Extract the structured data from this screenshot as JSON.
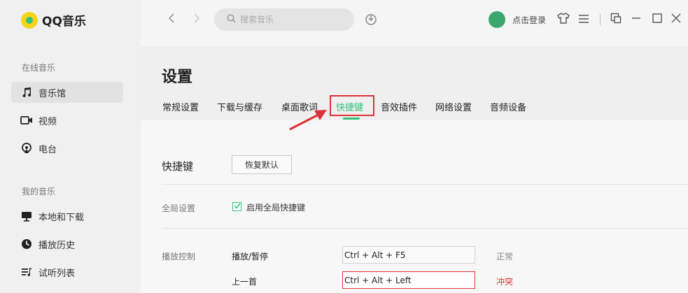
{
  "app": {
    "name": "QQ音乐"
  },
  "sidebar": {
    "online_title": "在线音乐",
    "online_items": [
      {
        "label": "音乐馆",
        "icon": "music-note-icon",
        "active": true
      },
      {
        "label": "视频",
        "icon": "video-icon",
        "active": false
      },
      {
        "label": "电台",
        "icon": "radio-icon",
        "active": false
      }
    ],
    "my_title": "我的音乐",
    "my_items": [
      {
        "label": "本地和下载",
        "icon": "monitor-icon"
      },
      {
        "label": "播放历史",
        "icon": "history-icon"
      },
      {
        "label": "试听列表",
        "icon": "playlist-icon"
      }
    ]
  },
  "topbar": {
    "search_placeholder": "搜索音乐",
    "login_label": "点击登录"
  },
  "settings": {
    "title": "设置",
    "tabs": [
      {
        "label": "常规设置",
        "active": false
      },
      {
        "label": "下载与缓存",
        "active": false
      },
      {
        "label": "桌面歌词",
        "active": false
      },
      {
        "label": "快捷键",
        "active": true
      },
      {
        "label": "音效插件",
        "active": false
      },
      {
        "label": "网络设置",
        "active": false
      },
      {
        "label": "音频设备",
        "active": false
      }
    ],
    "section_title": "快捷键",
    "restore_default_label": "恢复默认",
    "global_label": "全局设置",
    "enable_global_label": "启用全局快捷键",
    "enable_global_checked": true,
    "playback_label": "播放控制",
    "hotkeys": [
      {
        "action": "播放/暂停",
        "value": "Ctrl + Alt + F5",
        "status": "正常",
        "conflict": false
      },
      {
        "action": "上一首",
        "value": "Ctrl + Alt + Left",
        "status": "冲突",
        "conflict": true
      }
    ]
  },
  "colors": {
    "accent": "#31c27c",
    "conflict": "#e0323a"
  }
}
